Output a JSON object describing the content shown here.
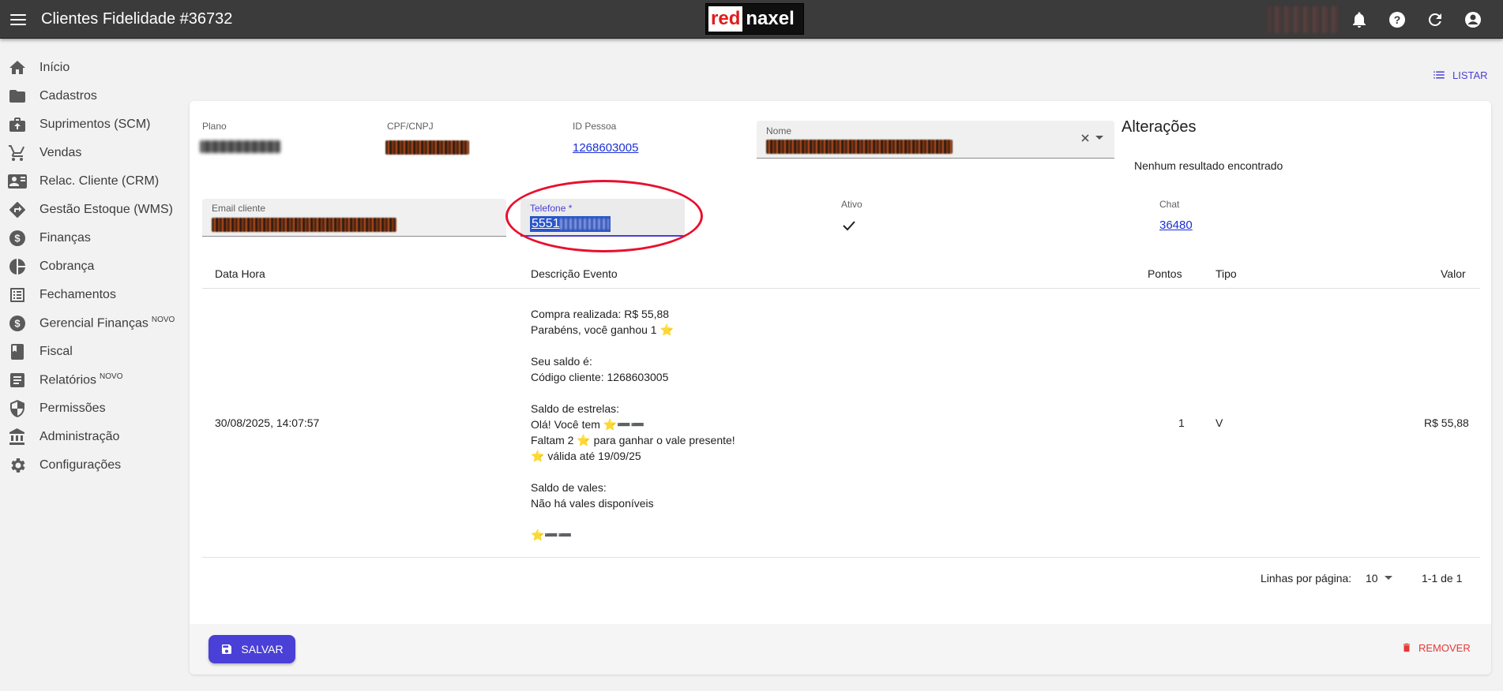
{
  "header": {
    "title": "Clientes Fidelidade #36732",
    "logo_red": "red",
    "logo_naxel": "naxel",
    "icons": [
      "menu-icon",
      "bell-icon",
      "help-icon",
      "refresh-icon",
      "account-icon"
    ]
  },
  "sidebar": {
    "items": [
      {
        "label": "Início",
        "icon": "home-icon",
        "badge": ""
      },
      {
        "label": "Cadastros",
        "icon": "folder-icon",
        "badge": ""
      },
      {
        "label": "Suprimentos (SCM)",
        "icon": "suprimentos-icon",
        "badge": ""
      },
      {
        "label": "Vendas",
        "icon": "cart-icon",
        "badge": ""
      },
      {
        "label": "Relac. Cliente (CRM)",
        "icon": "contact-card-icon",
        "badge": ""
      },
      {
        "label": "Gestão Estoque (WMS)",
        "icon": "directions-icon",
        "badge": ""
      },
      {
        "label": "Finanças",
        "icon": "dollar-circle-icon",
        "badge": ""
      },
      {
        "label": "Cobrança",
        "icon": "pie-chart-icon",
        "badge": ""
      },
      {
        "label": "Fechamentos",
        "icon": "list-alt-icon",
        "badge": ""
      },
      {
        "label": "Gerencial Finanças",
        "icon": "dollar-circle-icon",
        "badge": "NOVO"
      },
      {
        "label": "Fiscal",
        "icon": "book-icon",
        "badge": ""
      },
      {
        "label": "Relatórios",
        "icon": "document-icon",
        "badge": "NOVO"
      },
      {
        "label": "Permissões",
        "icon": "shield-icon",
        "badge": ""
      },
      {
        "label": "Administração",
        "icon": "bank-icon",
        "badge": ""
      },
      {
        "label": "Configurações",
        "icon": "gear-icon",
        "badge": ""
      }
    ]
  },
  "actions": {
    "listar": "LISTAR",
    "salvar": "SALVAR",
    "remover": "REMOVER"
  },
  "form": {
    "plano_label": "Plano",
    "cpf_label": "CPF/CNPJ",
    "id_pessoa_label": "ID Pessoa",
    "id_pessoa_value": "1268603005",
    "nome_label": "Nome",
    "email_label": "Email cliente",
    "telefone_label": "Telefone *",
    "telefone_value_prefix": "5551",
    "ativo_label": "Ativo",
    "chat_label": "Chat",
    "chat_value": "36480"
  },
  "alteracoes": {
    "title": "Alterações",
    "empty": "Nenhum resultado encontrado"
  },
  "table": {
    "headers": {
      "data_hora": "Data Hora",
      "descricao": "Descrição Evento",
      "pontos": "Pontos",
      "tipo": "Tipo",
      "valor": "Valor"
    },
    "rows": [
      {
        "data_hora": "30/08/2025, 14:07:57",
        "descricao": [
          "Compra realizada: R$ 55,88",
          "Parabéns, você ganhou 1 ⭐",
          "",
          "Seu saldo é:",
          "Código cliente: 1268603005",
          "",
          "Saldo de estrelas:",
          "Olá! Você tem ⭐➖➖",
          "Faltam 2 ⭐ para ganhar o vale presente!",
          "⭐ válida até 19/09/25",
          "",
          "Saldo de vales:",
          "Não há vales disponíveis",
          "",
          "⭐➖➖"
        ],
        "pontos": "1",
        "tipo": "V",
        "valor": "R$ 55,88"
      }
    ]
  },
  "pagination": {
    "rows_per_page_label": "Linhas por página:",
    "rows_per_page_value": "10",
    "range": "1-1 de 1"
  },
  "colors": {
    "accent": "#4a3fd6",
    "danger": "#e53935",
    "highlight_circle": "#e8102e",
    "topbar": "#3b3b3b"
  }
}
